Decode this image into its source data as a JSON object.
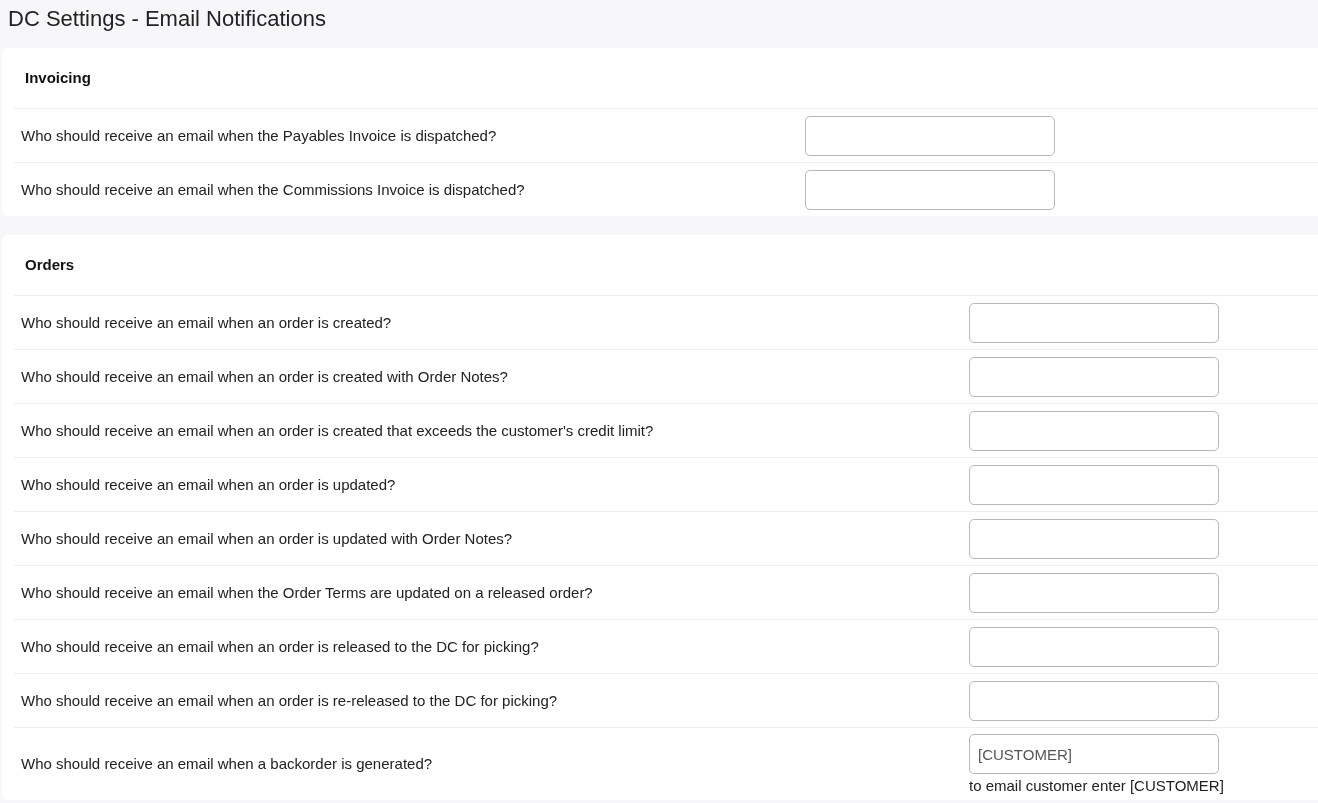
{
  "page_title": "DC Settings - Email Notifications",
  "sections": [
    {
      "title": "Invoicing",
      "rows": [
        {
          "question": "Who should receive an email when the Payables Invoice is dispatched?",
          "value": ""
        },
        {
          "question": "Who should receive an email when the Commissions Invoice is dispatched?",
          "value": ""
        }
      ]
    },
    {
      "title": "Orders",
      "rows": [
        {
          "question": "Who should receive an email when an order is created?",
          "value": ""
        },
        {
          "question": "Who should receive an email when an order is created with Order Notes?",
          "value": ""
        },
        {
          "question": "Who should receive an email when an order is created that exceeds the customer's credit limit?",
          "value": ""
        },
        {
          "question": "Who should receive an email when an order is updated?",
          "value": ""
        },
        {
          "question": "Who should receive an email when an order is updated with Order Notes?",
          "value": ""
        },
        {
          "question": "Who should receive an email when the Order Terms are updated on a released order?",
          "value": ""
        },
        {
          "question": "Who should receive an email when an order is released to the DC for picking?",
          "value": ""
        },
        {
          "question": "Who should receive an email when an order is re-released to the DC for picking?",
          "value": ""
        },
        {
          "question": "Who should receive an email when a backorder is generated?",
          "value": "[CUSTOMER]",
          "hint": "to email customer enter [CUSTOMER]"
        }
      ]
    }
  ]
}
